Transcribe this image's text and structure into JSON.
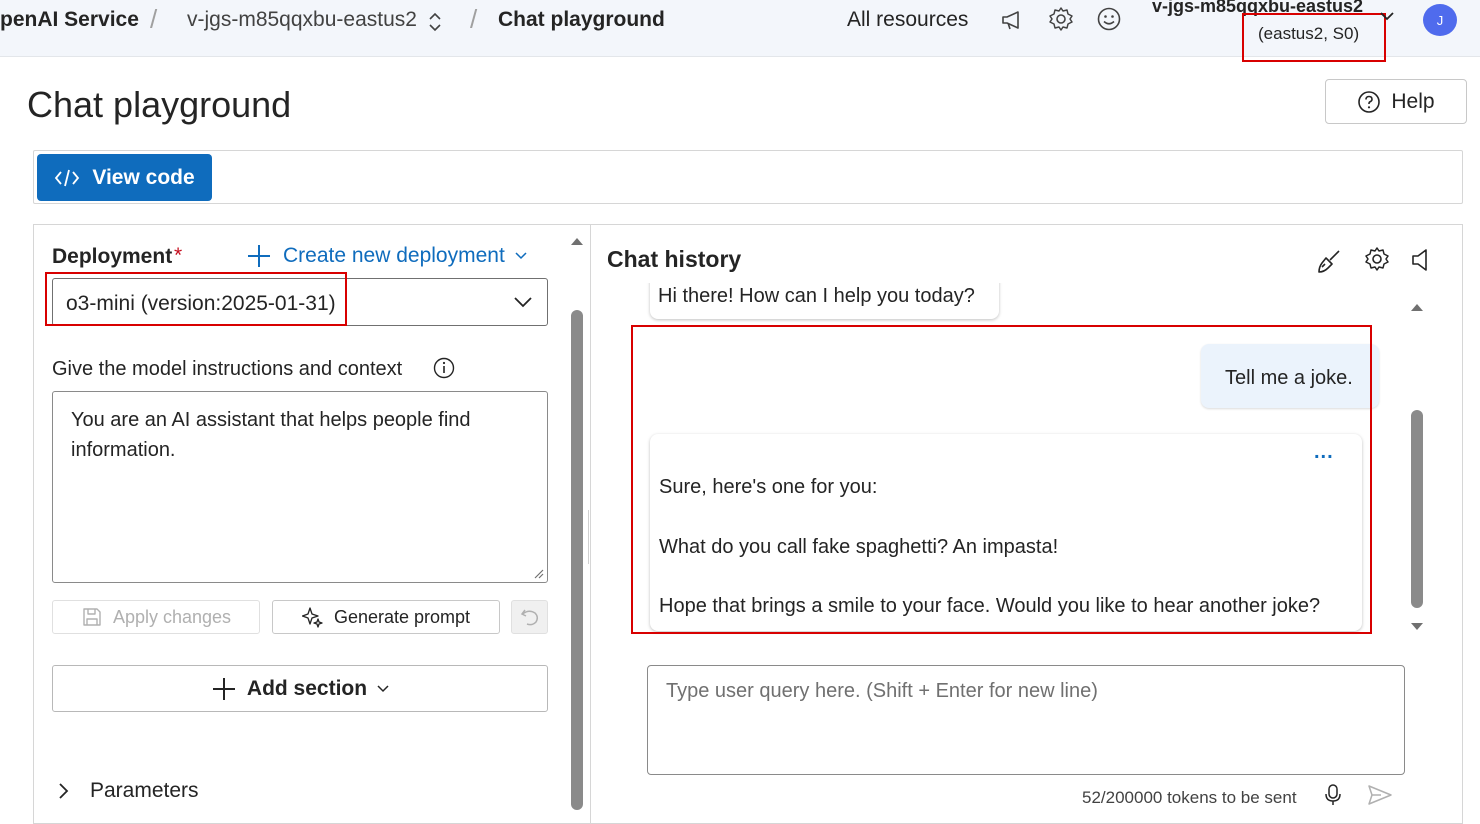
{
  "topbar": {
    "service": "penAI Service",
    "resource": "v-jgs-m85qqxbu-eastus2",
    "page": "Chat playground",
    "all_resources": "All resources",
    "account_name": "v-jgs-m85qqxbu-eastus2",
    "account_region": "(eastus2, S0)",
    "avatar_initial": "J"
  },
  "header": {
    "title": "Chat playground",
    "help_label": "Help",
    "view_code_label": "View code"
  },
  "setup": {
    "deployment_label": "Deployment",
    "required_mark": "*",
    "create_deployment_label": "Create new deployment",
    "deployment_value": "o3-mini (version:2025-01-31)",
    "instructions_label": "Give the model instructions and context",
    "system_message": "You are an AI assistant that helps people find information.",
    "apply_changes_label": "Apply changes",
    "generate_prompt_label": "Generate prompt",
    "add_section_label": "Add section",
    "parameters_label": "Parameters"
  },
  "chat": {
    "history_title": "Chat history",
    "messages": [
      {
        "role": "assistant",
        "text": "Hi there! How can I help you today?"
      },
      {
        "role": "user",
        "text": "Tell me a joke."
      },
      {
        "role": "assistant",
        "lines": [
          "Sure, here's one for you:",
          "What do you call fake spaghetti? An impasta!",
          "Hope that brings a smile to your face. Would you like to hear another joke?"
        ]
      }
    ],
    "more_label": "...",
    "input_placeholder": "Type user query here. (Shift + Enter for new line)",
    "token_count": "52/200000 tokens to be sent"
  },
  "colors": {
    "accent": "#0f6cbd",
    "highlight_box": "#d80000",
    "avatar_bg": "#4f6bed",
    "user_bubble": "#ebf3fc"
  }
}
